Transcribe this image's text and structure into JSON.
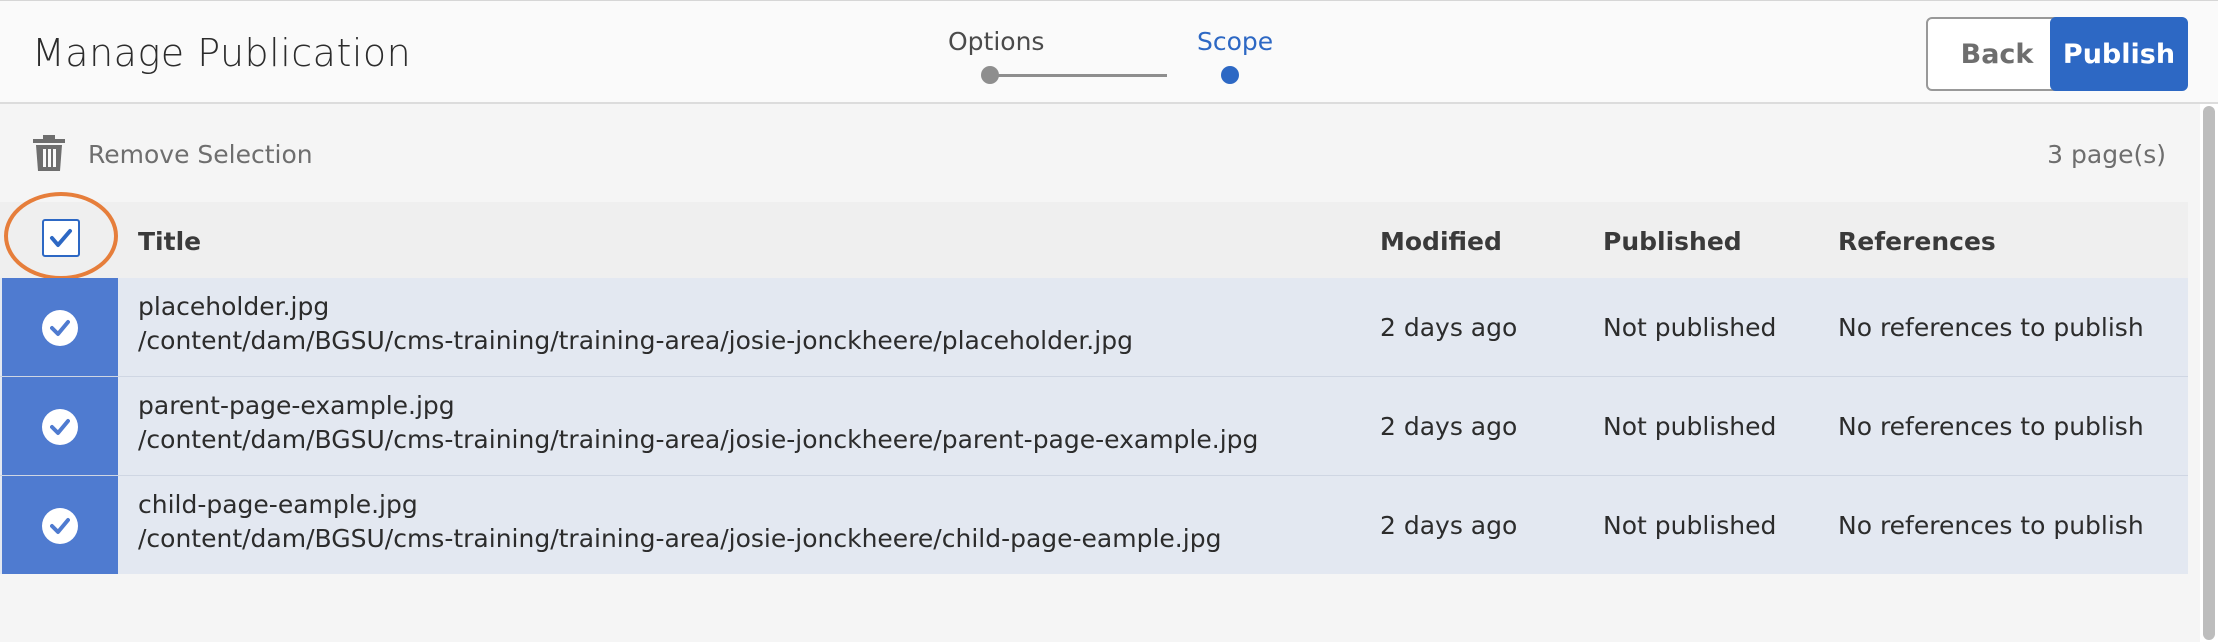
{
  "header": {
    "title": "Manage Publication",
    "steps": [
      {
        "label": "Options",
        "state": "done"
      },
      {
        "label": "Scope",
        "state": "current"
      }
    ],
    "back_label": "Back",
    "publish_label": "Publish"
  },
  "toolbar": {
    "remove_label": "Remove Selection",
    "count_label": "3 page(s)"
  },
  "table": {
    "columns": [
      "Title",
      "Modified",
      "Published",
      "References"
    ],
    "rows": [
      {
        "name": "placeholder.jpg",
        "path": "/content/dam/BGSU/cms-training/training-area/josie-jonckheere/placeholder.jpg",
        "modified": "2 days ago",
        "published": "Not published",
        "references": "No references to publish"
      },
      {
        "name": "parent-page-example.jpg",
        "path": "/content/dam/BGSU/cms-training/training-area/josie-jonckheere/parent-page-example.jpg",
        "modified": "2 days ago",
        "published": "Not published",
        "references": "No references to publish"
      },
      {
        "name": "child-page-eample.jpg",
        "path": "/content/dam/BGSU/cms-training/training-area/josie-jonckheere/child-page-eample.jpg",
        "modified": "2 days ago",
        "published": "Not published",
        "references": "No references to publish"
      }
    ]
  },
  "colors": {
    "accent": "#2d68c4",
    "highlight": "#e67e3b",
    "row_selected": "#e3e8f1"
  }
}
